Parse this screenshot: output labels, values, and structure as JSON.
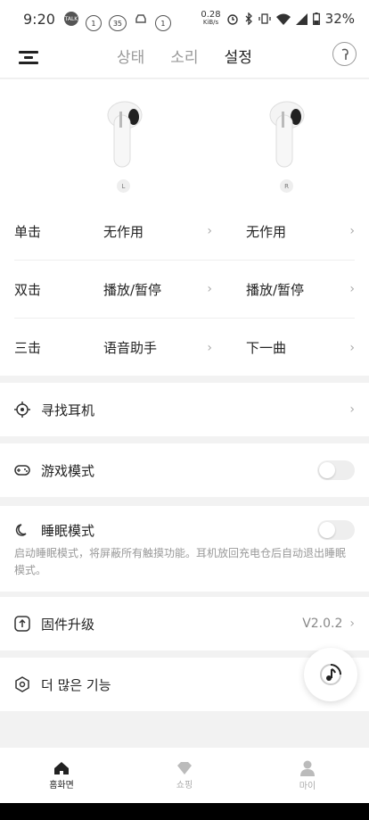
{
  "status_bar": {
    "time": "9:20",
    "notif_talk": "TALK",
    "badge_1": "1",
    "badge_2": "35",
    "badge_3": "1",
    "net_speed": "0.28",
    "net_unit": "KiB/s",
    "battery": "32%"
  },
  "header": {
    "tabs": [
      {
        "label": "상태",
        "active": false
      },
      {
        "label": "소리",
        "active": false
      },
      {
        "label": "설정",
        "active": true
      }
    ]
  },
  "buds": {
    "left_tag": "L",
    "right_tag": "R"
  },
  "gestures": [
    {
      "label": "单击",
      "left": "无作用",
      "right": "无作用"
    },
    {
      "label": "双击",
      "left": "播放/暂停",
      "right": "播放/暂停"
    },
    {
      "label": "三击",
      "left": "语音助手",
      "right": "下一曲"
    }
  ],
  "items": {
    "find": "寻找耳机",
    "game": "游戏模式",
    "sleep": "睡眠模式",
    "sleep_desc": "启动睡眠模式，将屏蔽所有触摸功能。耳机放回充电仓后自动退出睡眠模式。",
    "firmware": "固件升级",
    "firmware_version": "V2.0.2",
    "more": "더 많은 기능"
  },
  "toggles": {
    "game_on": false,
    "sleep_on": false
  },
  "bottom_nav": [
    {
      "label": "홈화면",
      "active": true
    },
    {
      "label": "쇼핑",
      "active": false
    },
    {
      "label": "마이",
      "active": false
    }
  ],
  "colors": {
    "accent": "#222222",
    "inactive": "#aaaaaa"
  }
}
